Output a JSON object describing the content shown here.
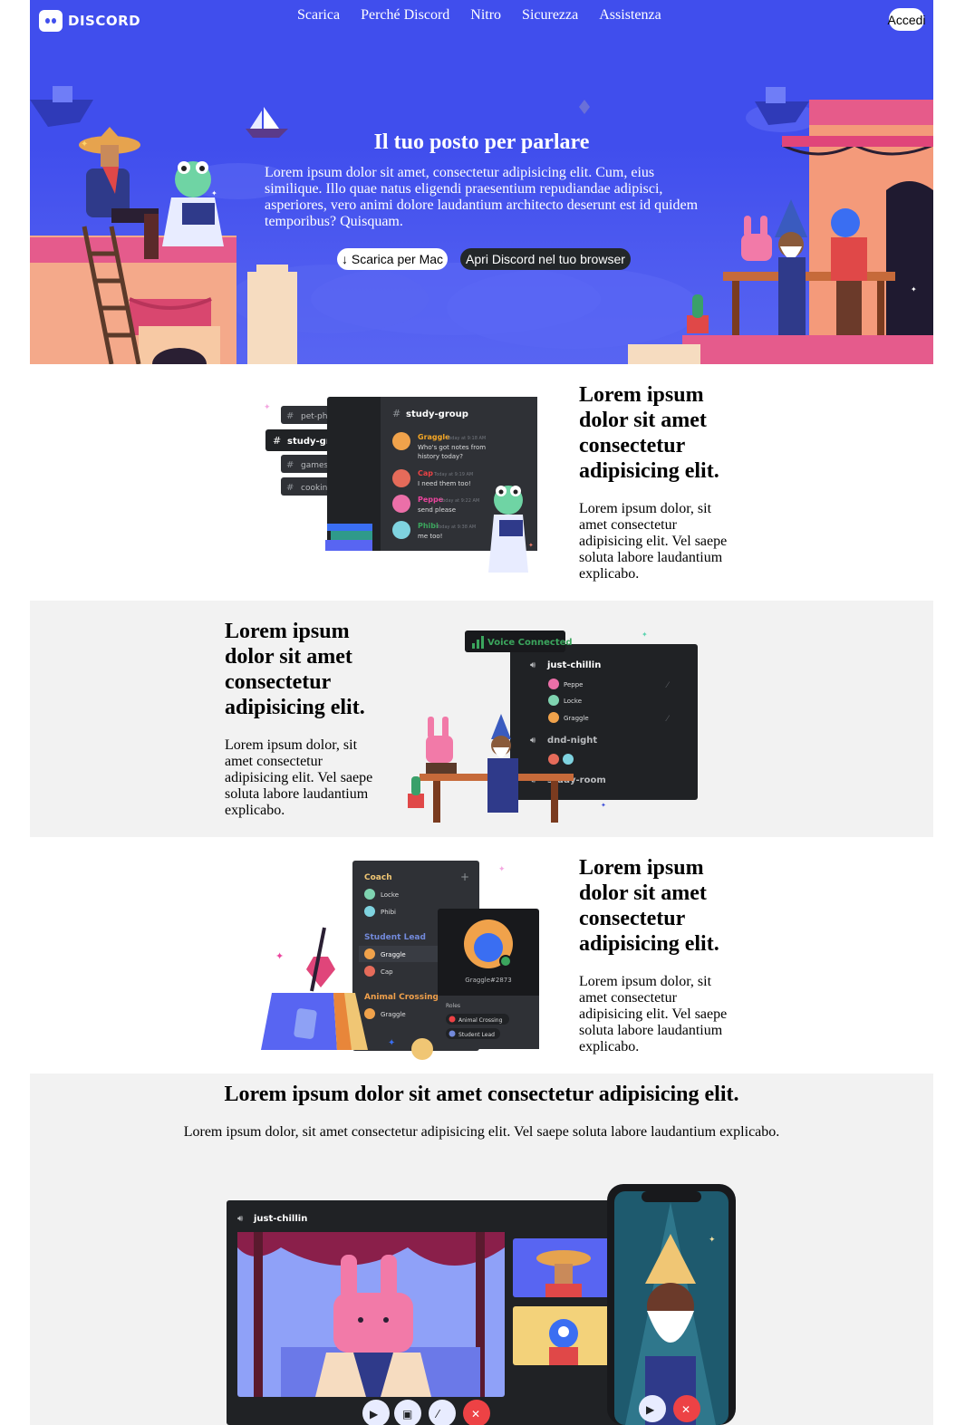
{
  "nav": {
    "logo_text": "DISCORD",
    "links": [
      "Scarica",
      "Perché Discord",
      "Nitro",
      "Sicurezza",
      "Assistenza"
    ],
    "login_label": "Accedi"
  },
  "hero": {
    "title": "Il tuo posto per parlare",
    "text": "Lorem ipsum dolor sit amet, consectetur adipisicing elit. Cum, eius similique. Illo quae natus eligendi praesentium repudiandae adipisci, asperiores, vero animi dolore laudantium architecto deserunt est id quidem temporibus? Quisquam.",
    "download_label": "↓ Scarica per Mac",
    "browser_label": "Apri Discord nel tuo browser"
  },
  "features": [
    {
      "title": "Lorem ipsum dolor sit amet consectetur adipisicing elit.",
      "text": "Lorem ipsum dolor, sit amet consectetur adipisicing elit. Vel saepe soluta labore laudantium explicabo."
    },
    {
      "title": "Lorem ipsum dolor sit amet consectetur adipisicing elit.",
      "text": "Lorem ipsum dolor, sit amet consectetur adipisicing elit. Vel saepe soluta labore laudantium explicabo."
    },
    {
      "title": "Lorem ipsum dolor sit amet consectetur adipisicing elit.",
      "text": "Lorem ipsum dolor, sit amet consectetur adipisicing elit. Vel saepe soluta labore laudantium explicabo."
    }
  ],
  "final": {
    "title": "Lorem ipsum dolor sit amet consectetur adipisicing elit.",
    "text": "Lorem ipsum dolor, sit amet consectetur adipisicing elit. Vel saepe soluta labore laudantium explicabo."
  },
  "illus1": {
    "channels": [
      "pet-photos",
      "study-group",
      "games",
      "cooking"
    ],
    "header": "study-group",
    "messages": [
      {
        "name": "Graggle",
        "time": "Today at 9:18 AM",
        "text": "Who's got notes from",
        "text2": "history today?",
        "color": "#f5a623"
      },
      {
        "name": "Cap",
        "time": "Today at 9:19 AM",
        "text": "I need them too!",
        "text2": "",
        "color": "#ed4245"
      },
      {
        "name": "Peppe",
        "time": "Today at 9:22 AM",
        "text": "send please",
        "text2": "",
        "color": "#eb459e"
      },
      {
        "name": "Phibi",
        "time": "Today at 9:38 AM",
        "text": "me too!",
        "text2": "",
        "color": "#3ba55d"
      }
    ]
  },
  "illus2": {
    "voice_status": "Voice Connected",
    "channels": [
      {
        "name": "just-chillin",
        "members": [
          "Peppe",
          "Locke",
          "Graggle"
        ]
      },
      {
        "name": "dnd-night",
        "members": []
      },
      {
        "name": "study-room",
        "members": []
      }
    ]
  },
  "illus3": {
    "groups": [
      {
        "name": "Coach",
        "members": [
          "Locke",
          "Phibi"
        ],
        "color": "#f0c674"
      },
      {
        "name": "Student Lead",
        "members": [
          "Graggle",
          "Cap"
        ],
        "color": "#7289da"
      },
      {
        "name": "Animal Crossing",
        "members": [
          "Graggle"
        ],
        "color": "#f0a04b"
      }
    ],
    "profile_tag": "Graggle#2873",
    "roles_label": "Roles",
    "roles": [
      "Animal Crossing",
      "Student Lead"
    ]
  },
  "illus4": {
    "channel": "just-chillin"
  }
}
